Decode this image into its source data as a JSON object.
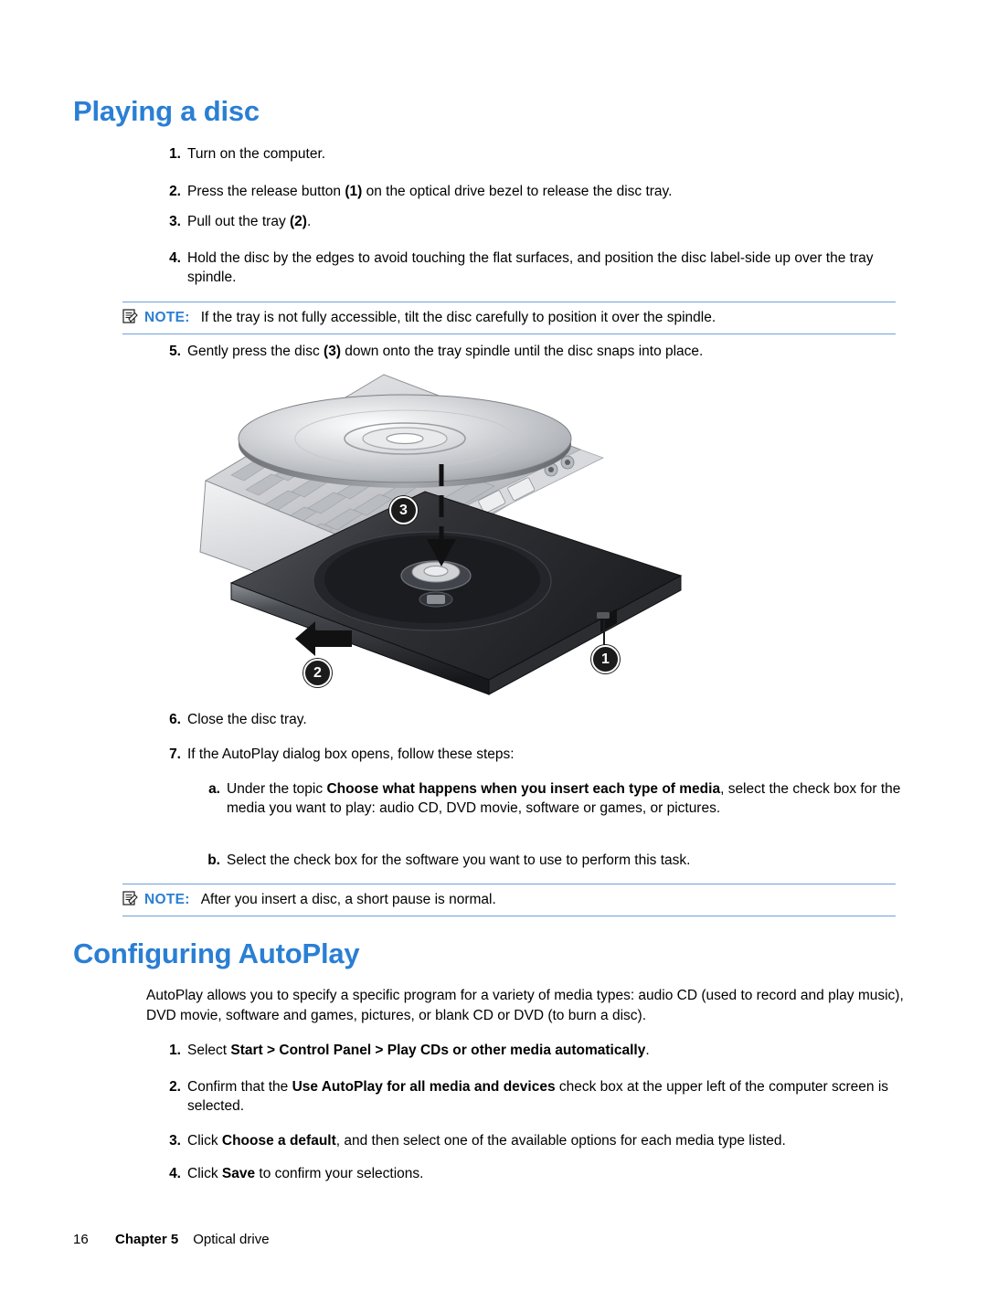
{
  "document": {
    "title_playing": "Playing a disc",
    "title_autoplay": "Configuring AutoPlay"
  },
  "playing_steps": [
    {
      "num": "1.",
      "text": "Turn on the computer."
    },
    {
      "num": "2.",
      "text": "Press the release button (1) on the optical drive bezel to release the disc tray."
    },
    {
      "num": "3.",
      "text": "Pull out the tray (2)."
    },
    {
      "num": "4.",
      "text": "Hold the disc by the edges to avoid touching the flat surfaces, and position the disc label-side up over the tray spindle."
    },
    {
      "num": "5.",
      "text": "Gently press the disc (3) down onto the tray spindle until the disc snaps into place."
    },
    {
      "num": "6.",
      "text": "Close the disc tray."
    },
    {
      "num": "7.",
      "text": "If the AutoPlay dialog box opens, follow these steps:"
    }
  ],
  "substeps": [
    {
      "num": "a.",
      "text": "Under the topic Choose what happens when you insert each type of media, select the check box for the media you want to play: audio CD, DVD movie, software or games, or pictures."
    },
    {
      "num": "b.",
      "text": "Select the check box for the software you want to use to perform this task."
    }
  ],
  "notes": [
    {
      "label": "NOTE:",
      "text": "If the tray is not fully accessible, tilt the disc carefully to position it over the spindle."
    },
    {
      "label": "NOTE:",
      "text": "After you insert a disc, a short pause is normal."
    }
  ],
  "autoplay": {
    "intro": "AutoPlay allows you to specify a specific program for a variety of media types: audio CD (used to record and play music), DVD movie, software and games, pictures, or blank CD or DVD (to burn a disc).",
    "steps": [
      {
        "num": "1.",
        "text": "Select Start > Control Panel > Play CDs or other media automatically."
      },
      {
        "num": "2.",
        "text": "Confirm that the Use AutoPlay for all media and devices check box at the upper left of the computer screen is selected."
      },
      {
        "num": "3.",
        "text": "Click Choose a default, and then select one of the available options for each media type listed."
      },
      {
        "num": "4.",
        "text": "Click Save to confirm your selections."
      }
    ]
  },
  "illustration": {
    "callouts": [
      "1",
      "2",
      "3"
    ],
    "alt": "Laptop with open optical drive tray and disc being pressed onto spindle"
  },
  "footer": {
    "page": "16",
    "chapter": "Chapter 5",
    "section": "Optical drive"
  },
  "colors": {
    "heading": "#2a7fd4",
    "note_rule": "#6f9fd8"
  }
}
